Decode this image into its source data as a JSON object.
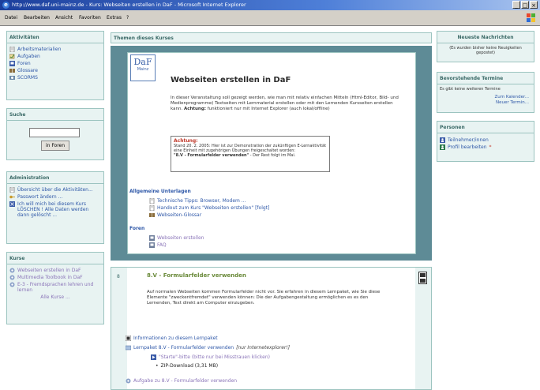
{
  "window": {
    "title": "http://www.daf.uni-mainz.de - Kurs: Webseiten erstellen in DaF - Microsoft Internet Explorer",
    "minimize": "_",
    "maximize": "□",
    "close": "×"
  },
  "menu": [
    "Datei",
    "Bearbeiten",
    "Ansicht",
    "Favoriten",
    "Extras",
    "?"
  ],
  "left": {
    "activities": {
      "title": "Aktivitäten",
      "items": [
        "Arbeitsmaterialien",
        "Aufgaben",
        "Foren",
        "Glossare",
        "SCORMS"
      ]
    },
    "search": {
      "title": "Suche",
      "button": "in Foren"
    },
    "admin": {
      "title": "Administration",
      "items": [
        "Übersicht über die Aktivitäten...",
        "Passwort ändern ...",
        "Ich will mich bei diesem Kurs LÖSCHEN ! Alle Daten werden dann gelöscht ..."
      ]
    },
    "courses": {
      "title": "Kurse",
      "items": [
        "Webseiten erstellen in DaF",
        "Multimedia Toolbook in DaF",
        "E-3 - Fremdsprachen lehren und lernen"
      ],
      "all": "Alle Kurse ..."
    }
  },
  "center": {
    "header": "Themen dieses Kurses",
    "logo": {
      "top": "DaF",
      "bottom": "Mainz"
    },
    "course_title": "Webseiten erstellen in DaF",
    "intro": "In dieser Veranstaltung soll gezeigt werden, wie man mit relativ einfachen Mitteln (Html-Editor, Bild- und Medienprogramme) Textseiten mit Lernmaterial erstellen oder mit den Lernenden Kursseiten erstellen kann.",
    "intro_bold": "Achtung:",
    "intro_tail": "funktioniert nur mit Internet Explorer (auch lokal/offline)",
    "notice": {
      "title": "Achtung:",
      "line1": "Stand 20. 2. 2005: Hier ist zur Demonstration der zukünftigen E-Lernaktivität eine Einheit mit zugehörigen Übungen freigeschaltet worden:",
      "bold": "\"8.V - Formularfelder verwenden\"",
      "line2": "- Der Rest folgt im Mai."
    },
    "general_title": "Allgemeine Unterlagen",
    "general_items": [
      "Technische Tipps: Browser, Modem ...",
      "Handout zum Kurs \"Webseiten erstellen\" [folgt]",
      "Webseiten-Glossar"
    ],
    "forum_title": "Foren",
    "forum_items": [
      "Webseiten erstellen",
      "FAQ"
    ]
  },
  "section": {
    "number": "8",
    "title": "8.V - Formularfelder verwenden",
    "text": "Auf normalen Webseiten kommen Formularfelder nicht vor. Sie erfahren in diesem Lernpaket, wie Sie diese Elemente \"zweckentfremdet\" verwenden können: Die der Aufgabengestaltung ermöglichen es es den Lernenden, Text direkt am Computer einzugeben.",
    "info": "Informationen zu diesem Lernpaket",
    "package_link": "Lernpaket 8.V - Formularfelder verwenden",
    "package_note": "[nur Internetexplorer!]",
    "start_link": "\"Starte\"-bitte (bitte nur bei Misstrauen klicken)",
    "zip": "ZIP-Download (3,31 MB)",
    "task": "Aufgabe zu 8.V - Formularfelder verwenden"
  },
  "right": {
    "news": {
      "title": "Neueste Nachrichten",
      "text": "(Es wurden bisher keine Neuigkeiten gepostet)"
    },
    "events": {
      "title": "Bevorstehende Termine",
      "text": "Es gibt keine weiteren Termine",
      "link1": "Zum Kalender...",
      "link2": "Neuer Termin..."
    },
    "persons": {
      "title": "Personen",
      "items": [
        "Teilnehmer/innen",
        "Profil bearbeiten"
      ]
    }
  },
  "colors": {
    "accent": "#5e8b96",
    "block_bg": "#e8f3f2",
    "link": "#2f58a8",
    "title_red": "#c0392b"
  }
}
